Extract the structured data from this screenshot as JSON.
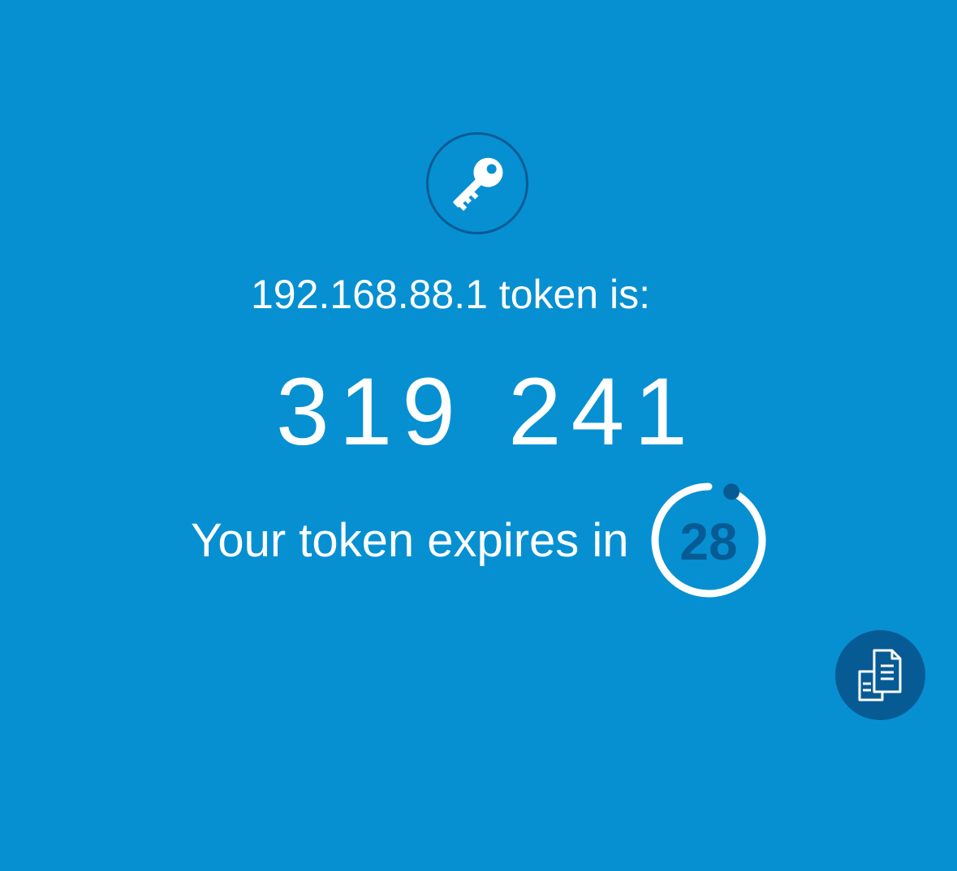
{
  "header": {
    "icon": "key-icon",
    "server_line": "192.168.88.1 token is:"
  },
  "token": {
    "part1": "319",
    "part2": "241"
  },
  "expiry": {
    "label": "Your token expires in",
    "seconds_remaining": "28",
    "ring_fraction_elapsed": 0.07
  },
  "actions": {
    "copy_icon": "copy-icon"
  },
  "colors": {
    "background": "#0690d2",
    "accent_dark": "#075b94",
    "foreground": "#ffffff"
  }
}
